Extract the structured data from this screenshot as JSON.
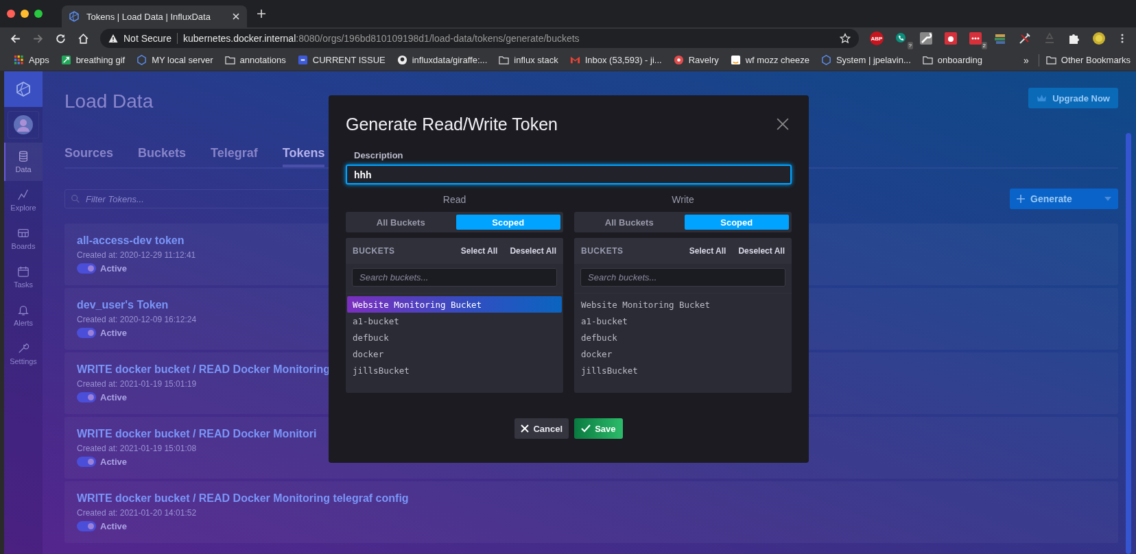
{
  "browser": {
    "tab_title": "Tokens | Load Data | InfluxData",
    "security": "Not Secure",
    "url_host": "kubernetes.docker.internal",
    "url_path": ":8080/orgs/196bd810109198d1/load-data/tokens/generate/buckets",
    "bookmarks": [
      {
        "label": "Apps",
        "kind": "apps"
      },
      {
        "label": "breathing gif",
        "kind": "green"
      },
      {
        "label": "MY local server",
        "kind": "influx"
      },
      {
        "label": "annotations",
        "kind": "folder"
      },
      {
        "label": "CURRENT ISSUE",
        "kind": "z"
      },
      {
        "label": "influxdata/giraffe:...",
        "kind": "github"
      },
      {
        "label": "influx stack",
        "kind": "folder"
      },
      {
        "label": "Inbox (53,593) - ji...",
        "kind": "mail"
      },
      {
        "label": "Ravelry",
        "kind": "r"
      },
      {
        "label": "wf mozz cheeze",
        "kind": "amazon"
      },
      {
        "label": "System | jpelavin...",
        "kind": "influx"
      },
      {
        "label": "onboarding",
        "kind": "folder"
      }
    ],
    "more": "»",
    "other_bookmarks": "Other Bookmarks",
    "extensions": [
      {
        "kind": "abp",
        "label": "ABP"
      },
      {
        "kind": "phone",
        "badge": "?"
      },
      {
        "kind": "wrench"
      },
      {
        "kind": "bug"
      },
      {
        "kind": "dots",
        "badge": "2"
      },
      {
        "kind": "books"
      },
      {
        "kind": "tool"
      },
      {
        "kind": "recycle"
      },
      {
        "kind": "puzzle"
      },
      {
        "kind": "flower"
      }
    ]
  },
  "sidebar": {
    "items": [
      {
        "label": "Data",
        "kind": "database",
        "selected": true
      },
      {
        "label": "Explore",
        "kind": "graph",
        "selected": false
      },
      {
        "label": "Boards",
        "kind": "grid",
        "selected": false
      },
      {
        "label": "Tasks",
        "kind": "calendar",
        "selected": false
      },
      {
        "label": "Alerts",
        "kind": "bell",
        "selected": false
      },
      {
        "label": "Settings",
        "kind": "wrench",
        "selected": false
      }
    ]
  },
  "page": {
    "title": "Load Data",
    "upgrade": "Upgrade Now",
    "tabs": [
      {
        "label": "Sources",
        "selected": false
      },
      {
        "label": "Buckets",
        "selected": false
      },
      {
        "label": "Telegraf",
        "selected": false
      },
      {
        "label": "Tokens",
        "selected": true
      }
    ],
    "filter_placeholder": "Filter Tokens...",
    "generate": "Generate",
    "tokens": [
      {
        "name": "all-access-dev token",
        "created": "Created at: 2020-12-29 11:12:41",
        "status": "Active",
        "active": true
      },
      {
        "name": "dev_user's Token",
        "created": "Created at: 2020-12-09 16:12:24",
        "status": "Active",
        "active": true
      },
      {
        "name": "WRITE docker bucket / READ Docker Monitoring",
        "created": "Created at: 2021-01-19 15:01:19",
        "status": "Active",
        "active": true
      },
      {
        "name": "WRITE docker bucket / READ Docker Monitori",
        "created": "Created at: 2021-01-19 15:01:08",
        "status": "Active",
        "active": true
      },
      {
        "name": "WRITE docker bucket / READ Docker Monitoring telegraf config",
        "created": "Created at: 2021-01-20 14:01:52",
        "status": "Active",
        "active": true
      }
    ]
  },
  "modal": {
    "title": "Generate Read/Write Token",
    "description_label": "Description",
    "description_value": "hhh",
    "columns": [
      {
        "heading": "Read",
        "modes": [
          {
            "label": "All Buckets",
            "selected": false
          },
          {
            "label": "Scoped",
            "selected": true
          }
        ],
        "panel_title": "BUCKETS",
        "select_all": "Select All",
        "deselect_all": "Deselect All",
        "search_placeholder": "Search buckets...",
        "buckets": [
          {
            "name": "Website Monitoring Bucket",
            "selected": true
          },
          {
            "name": "a1-bucket",
            "selected": false
          },
          {
            "name": "defbuck",
            "selected": false
          },
          {
            "name": "docker",
            "selected": false
          },
          {
            "name": "jillsBucket",
            "selected": false
          }
        ]
      },
      {
        "heading": "Write",
        "modes": [
          {
            "label": "All Buckets",
            "selected": false
          },
          {
            "label": "Scoped",
            "selected": true
          }
        ],
        "panel_title": "BUCKETS",
        "select_all": "Select All",
        "deselect_all": "Deselect All",
        "search_placeholder": "Search buckets...",
        "buckets": [
          {
            "name": "Website Monitoring Bucket",
            "selected": false
          },
          {
            "name": "a1-bucket",
            "selected": false
          },
          {
            "name": "defbuck",
            "selected": false
          },
          {
            "name": "docker",
            "selected": false
          },
          {
            "name": "jillsBucket",
            "selected": false
          }
        ]
      }
    ],
    "cancel": "Cancel",
    "save": "Save"
  }
}
